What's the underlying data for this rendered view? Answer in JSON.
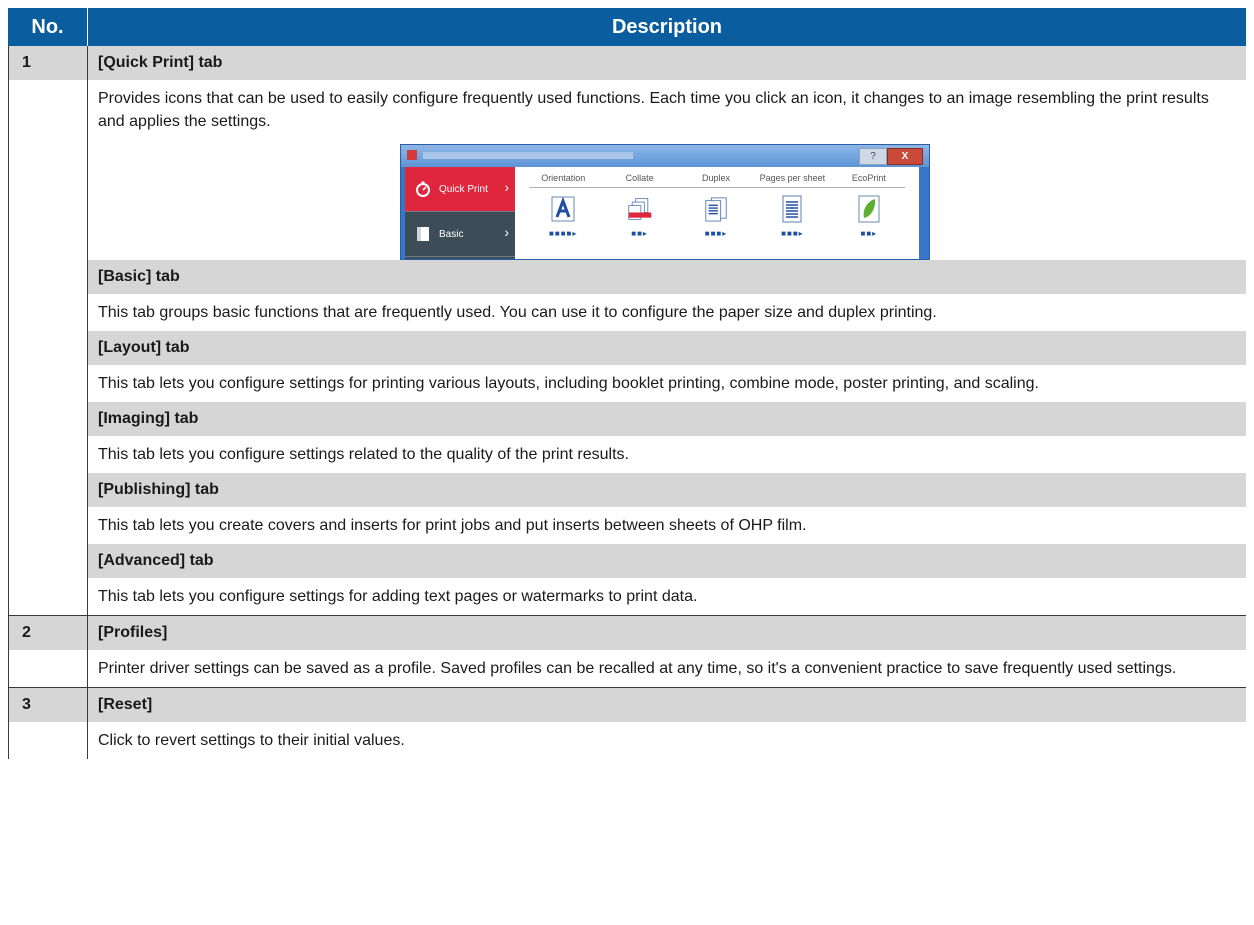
{
  "header": {
    "col_no": "No.",
    "col_desc": "Description"
  },
  "rows": [
    {
      "no": "1",
      "sections": [
        {
          "title": "[Quick Print] tab",
          "text": "Provides icons that can be used to easily configure frequently used functions. Each time you click an icon, it changes to an image resembling the print results and applies the settings."
        },
        {
          "title": "[Basic] tab",
          "text": "This tab groups basic functions that are frequently used. You can use it to configure the paper size and duplex printing."
        },
        {
          "title": "[Layout] tab",
          "text": "This tab lets you configure settings for printing various layouts, including booklet printing, combine mode, poster printing, and scaling."
        },
        {
          "title": "[Imaging] tab",
          "text": "This tab lets you configure settings related to the quality of the print results."
        },
        {
          "title": "[Publishing] tab",
          "text": "This tab lets you create covers and inserts for print jobs and put inserts between sheets of OHP film."
        },
        {
          "title": "[Advanced] tab",
          "text": "This tab lets you configure settings for adding text pages or watermarks to print data."
        }
      ]
    },
    {
      "no": "2",
      "sections": [
        {
          "title": "[Profiles]",
          "text": "Printer driver settings can be saved as a profile. Saved profiles can be recalled at any time, so it's a convenient practice to save frequently used settings."
        }
      ]
    },
    {
      "no": "3",
      "sections": [
        {
          "title": "[Reset]",
          "text": "Click to revert settings to their initial values."
        }
      ]
    }
  ],
  "screenshot": {
    "sidebar": [
      {
        "label": "Quick Print",
        "icon": "stopwatch-icon",
        "color": "#e0263c"
      },
      {
        "label": "Basic",
        "icon": "page-icon",
        "color": "#3c4d58"
      }
    ],
    "columns": [
      "Orientation",
      "Collate",
      "Duplex",
      "Pages per sheet",
      "EcoPrint"
    ],
    "icons": [
      "orientation-icon",
      "collate-icon",
      "duplex-icon",
      "pages-per-sheet-icon",
      "ecoprint-leaf-icon"
    ]
  }
}
